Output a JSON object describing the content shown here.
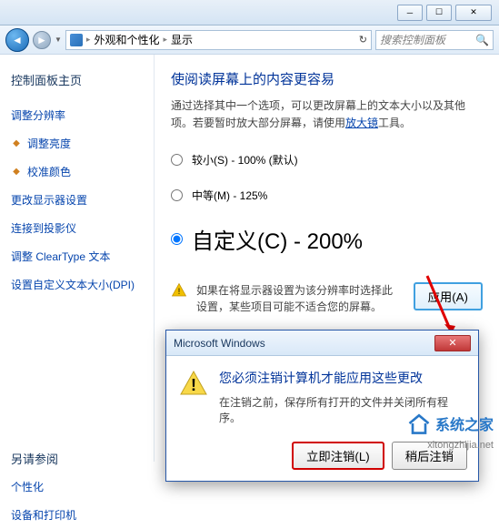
{
  "chrome": {
    "minimize": "─",
    "maximize": "☐",
    "close": "✕"
  },
  "nav": {
    "back_glyph": "◄",
    "fwd_glyph": "►",
    "dropdown_glyph": "▼",
    "breadcrumb1": "外观和个性化",
    "breadcrumb2": "显示",
    "sep": "▸",
    "refresh": "↻",
    "search_placeholder": "搜索控制面板",
    "search_icon": "🔍"
  },
  "sidebar": {
    "home": "控制面板主页",
    "items": [
      "调整分辨率",
      "调整亮度",
      "校准颜色",
      "更改显示器设置",
      "连接到投影仪",
      "调整 ClearType 文本",
      "设置自定义文本大小(DPI)"
    ],
    "see_also": "另请参阅",
    "see_also_items": [
      "个性化",
      "设备和打印机"
    ]
  },
  "content": {
    "title": "使阅读屏幕上的内容更容易",
    "desc1": "通过选择其中一个选项，可以更改屏幕上的文本大小以及其他项。若要暂时放大部分屏幕，请使用",
    "magnifier_link": "放大镜",
    "desc2": "工具。",
    "options": [
      {
        "label": "较小(S) - 100% (默认)",
        "checked": false
      },
      {
        "label": "中等(M) - 125%",
        "checked": false
      },
      {
        "label": "自定义(C) - 200%",
        "checked": true
      }
    ],
    "warn": "如果在将显示器设置为该分辨率时选择此设置，某些项目可能不适合您的屏幕。",
    "apply": "应用(A)"
  },
  "dialog": {
    "title": "Microsoft Windows",
    "heading": "您必须注销计算机才能应用这些更改",
    "sub": "在注销之前，保存所有打开的文件并关闭所有程序。",
    "btn_primary": "立即注销(L)",
    "btn_secondary": "稍后注销"
  },
  "watermark": {
    "brand": "系统之家",
    "url": "xitongzhijia.net"
  }
}
